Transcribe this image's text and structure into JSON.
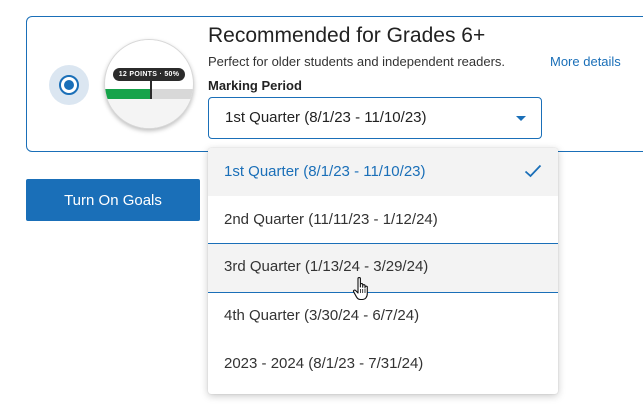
{
  "goal_option": {
    "title": "Recommended for Grades 6+",
    "subtitle": "Perfect for older students and independent readers.",
    "more_details": "More details",
    "thumbnail_label": "12 POINTS · 50%",
    "thumbnail_progress": 0.5
  },
  "marking_period": {
    "label": "Marking Period",
    "selected_value": "1st Quarter (8/1/23 - 11/10/23)",
    "options": [
      {
        "label": "1st Quarter (8/1/23 - 11/10/23)",
        "selected": true
      },
      {
        "label": "2nd Quarter (11/11/23 - 1/12/24)",
        "selected": false
      },
      {
        "label": "3rd Quarter (1/13/24 - 3/29/24)",
        "selected": false,
        "hovered": true
      },
      {
        "label": "4th Quarter (3/30/24 - 6/7/24)",
        "selected": false
      },
      {
        "label": "2023 - 2024 (8/1/23 - 7/31/24)",
        "selected": false
      }
    ]
  },
  "actions": {
    "turn_on_goals": "Turn On Goals"
  },
  "colors": {
    "accent": "#1a6fb8",
    "progress_fill": "#16a34a"
  },
  "icons": {
    "check": "checkmark-icon",
    "caret": "caret-down-icon",
    "cursor": "hand-pointer-icon"
  }
}
